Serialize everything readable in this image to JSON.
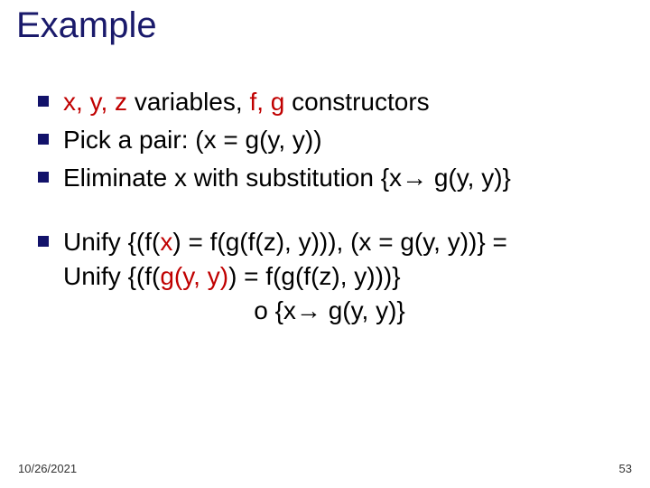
{
  "title": "Example",
  "bullets": {
    "b1_pre": "x, y, z",
    "b1_mid": " variables, ",
    "b1_fg": "f, g",
    "b1_post": " constructors",
    "b2": "Pick a pair: (x = g(y, y))",
    "b3_pre": "Eliminate x with substitution {x",
    "b3_post": " g(y, y)}",
    "b4_l1_pre": "Unify {(f(",
    "b4_l1_x": "x",
    "b4_l1_post": ") = f(g(f(z), y))), (x = g(y, y))} =",
    "b4_l2_pre": "Unify {(f(",
    "b4_l2_g": "g(y, y)",
    "b4_l2_post": ") = f(g(f(z), y)))}",
    "b4_l3_pre": "o {x",
    "b4_l3_post": " g(y, y)}"
  },
  "arrow": "→",
  "footer": {
    "date": "10/26/2021",
    "page": "53"
  }
}
